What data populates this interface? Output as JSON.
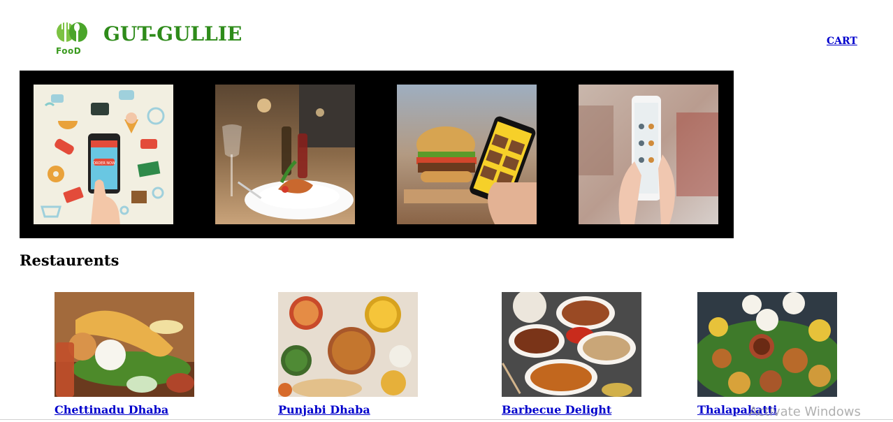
{
  "header": {
    "logo_text": "FooD",
    "brand": "GUT-GULLIE",
    "cart_label": "CART"
  },
  "banner": {
    "slides": [
      {
        "name": "food-delivery-illustration",
        "alt": "order now app illustration",
        "screen_text": "ORDER NOW"
      },
      {
        "name": "restaurant-table-photo",
        "alt": "restaurant dining table"
      },
      {
        "name": "burger-phone-photo",
        "alt": "burger with phone app"
      },
      {
        "name": "order-online-phone-photo",
        "alt": "order food online phone"
      }
    ]
  },
  "restaurants": {
    "title": "Restaurents",
    "items": [
      {
        "name": "Chettinadu Dhaba"
      },
      {
        "name": "Punjabi Dhaba"
      },
      {
        "name": "Barbecue Delight"
      },
      {
        "name": "Thalapakatti"
      }
    ]
  },
  "overlay": {
    "watermark": "Activate Windows"
  },
  "colors": {
    "brand_green": "#2e8b1a",
    "link_blue": "#0000cc",
    "banner_bg": "#000000"
  }
}
